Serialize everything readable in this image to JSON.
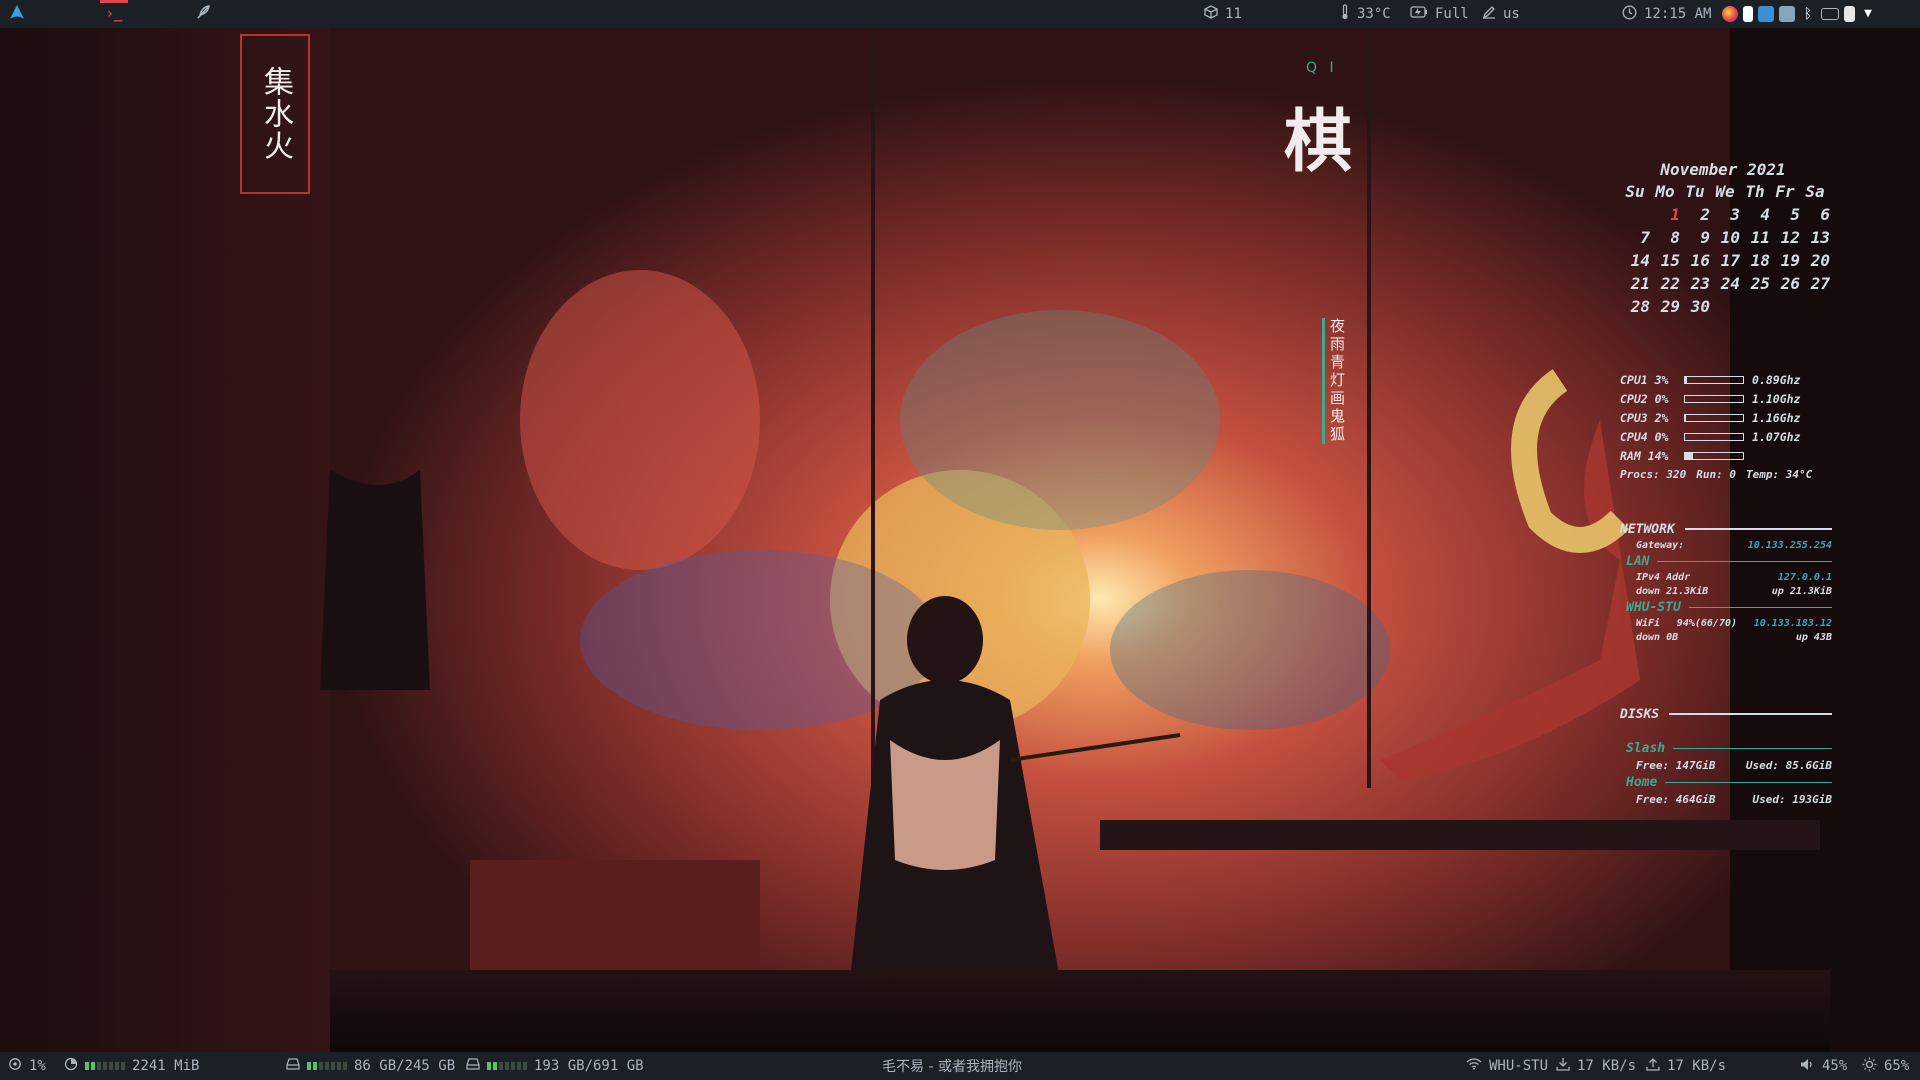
{
  "topbar": {
    "workspaces": [
      {
        "icon": "arch-logo-icon"
      },
      {
        "icon": "terminal-icon",
        "label": "›_"
      },
      {
        "icon": "feather-icon"
      }
    ],
    "updates": {
      "icon": "package-icon",
      "count": "11"
    },
    "temperature": {
      "icon": "thermometer-icon",
      "value": "33°C"
    },
    "battery": {
      "icon": "battery-icon",
      "value": "Full"
    },
    "keyboard": {
      "icon": "pen-icon",
      "value": "us"
    },
    "clock": {
      "icon": "clock-icon",
      "value": "12:15 AM"
    },
    "tray": [
      "firefox-icon",
      "l-app-icon",
      "vm-icon",
      "network-manager-icon",
      "bluetooth-icon",
      "keyboard-icon",
      "usb-icon",
      "wifi-tray-icon"
    ]
  },
  "wallpaper": {
    "title_latin": "Q I",
    "title_char": "棋",
    "vertical_caption": "夜雨青灯画鬼狐",
    "seal_text": "集水火"
  },
  "conky": {
    "calendar": {
      "month": "November 2021",
      "days_of_week": [
        "Su",
        "Mo",
        "Tu",
        "We",
        "Th",
        "Fr",
        "Sa"
      ],
      "weeks": [
        [
          "",
          "1",
          "2",
          "3",
          "4",
          "5",
          "6"
        ],
        [
          "7",
          "8",
          "9",
          "10",
          "11",
          "12",
          "13"
        ],
        [
          "14",
          "15",
          "16",
          "17",
          "18",
          "19",
          "20"
        ],
        [
          "21",
          "22",
          "23",
          "24",
          "25",
          "26",
          "27"
        ],
        [
          "28",
          "29",
          "30",
          "",
          "",
          "",
          ""
        ]
      ],
      "today": "1"
    },
    "system": {
      "cpus": [
        {
          "label": "CPU1 3%",
          "usage": 0.03,
          "freq": "0.89Ghz"
        },
        {
          "label": "CPU2 0%",
          "usage": 0.0,
          "freq": "1.10Ghz"
        },
        {
          "label": "CPU3 2%",
          "usage": 0.02,
          "freq": "1.16Ghz"
        },
        {
          "label": "CPU4 0%",
          "usage": 0.0,
          "freq": "1.07Ghz"
        }
      ],
      "ram": {
        "label": "RAM 14%",
        "usage": 0.14
      },
      "procs": "Procs: 320",
      "run": "Run: 0",
      "temp": "Temp: 34°C"
    },
    "network": {
      "title": "NETWORK",
      "gateway_label": "Gateway:",
      "gateway": "10.133.255.254",
      "lan": {
        "title": "LAN",
        "addr_label": "IPv4 Addr",
        "addr": "127.0.0.1",
        "down": "down 21.3KiB",
        "up": "up 21.3KiB"
      },
      "wifi": {
        "title": "WHU-STU",
        "label": "WiFi",
        "signal": "94%(66/70)",
        "addr": "10.133.183.12",
        "down": "down 0B",
        "up": "up 43B"
      }
    },
    "disks": {
      "title": "DISKS",
      "slash": {
        "title": "Slash",
        "free": "Free: 147GiB",
        "used": "Used: 85.6GiB"
      },
      "home": {
        "title": "Home",
        "free": "Free: 464GiB",
        "used": "Used: 193GiB"
      }
    }
  },
  "bottombar": {
    "cpu": {
      "icon": "cpu-chip-icon",
      "value": "1%"
    },
    "memory": {
      "icon": "memory-pie-icon",
      "value": "2241 MiB",
      "fraction": 0.29
    },
    "disk_root": {
      "icon": "hdd-icon",
      "value": "86 GB/245 GB",
      "fraction": 0.35
    },
    "disk_home": {
      "icon": "hdd-icon",
      "value": "193 GB/691 GB",
      "fraction": 0.28
    },
    "now_playing": "毛不易 - 或者我拥抱你",
    "wifi": {
      "icon": "wifi-icon",
      "value": "WHU-STU"
    },
    "download": {
      "icon": "download-icon",
      "value": "17 KB/s"
    },
    "upload": {
      "icon": "upload-icon",
      "value": "17 KB/s"
    },
    "volume": {
      "icon": "speaker-icon",
      "value": "45%"
    },
    "brightness": {
      "icon": "sun-icon",
      "value": "65%"
    }
  },
  "colors": {
    "bar_bg": "#1b2027",
    "accent_red": "#e0464b",
    "conky_green": "#3fa88e",
    "conky_ip": "#3aa7b7"
  }
}
